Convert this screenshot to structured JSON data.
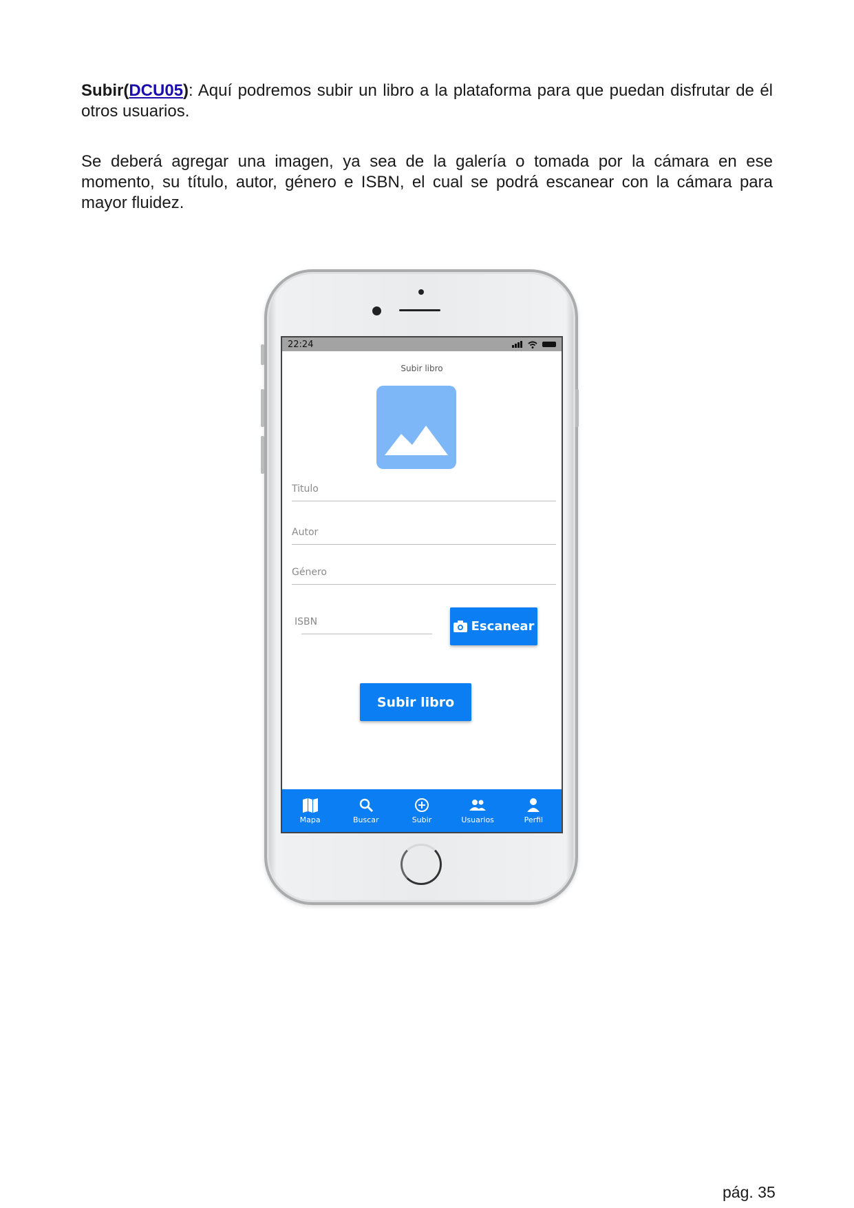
{
  "doc": {
    "intro_bold": "Subir(",
    "intro_link": "DCU05",
    "intro_bold_end": ")",
    "intro_rest": ": Aquí podremos subir un libro a la plataforma para que puedan disfrutar de él otros usuarios.",
    "paragraph2": "Se deberá agregar una imagen, ya sea de la galería o tomada por la cámara en ese momento, su título, autor, género e ISBN, el cual se podrá escanear con la cámara para mayor fluidez.",
    "page_number": "pág. 35"
  },
  "phone": {
    "status_time": "22:24",
    "screen_title": "Subir libro",
    "fields": [
      "Titulo",
      "Autor",
      "Género",
      "ISBN"
    ],
    "scan_button": "Escanear",
    "submit_button": "Subir libro",
    "nav": [
      "Mapa",
      "Buscar",
      "Subir",
      "Usuarios",
      "Perfil"
    ],
    "accent_color": "#0a7ef2",
    "placeholder_color": "#7eb7f7"
  }
}
